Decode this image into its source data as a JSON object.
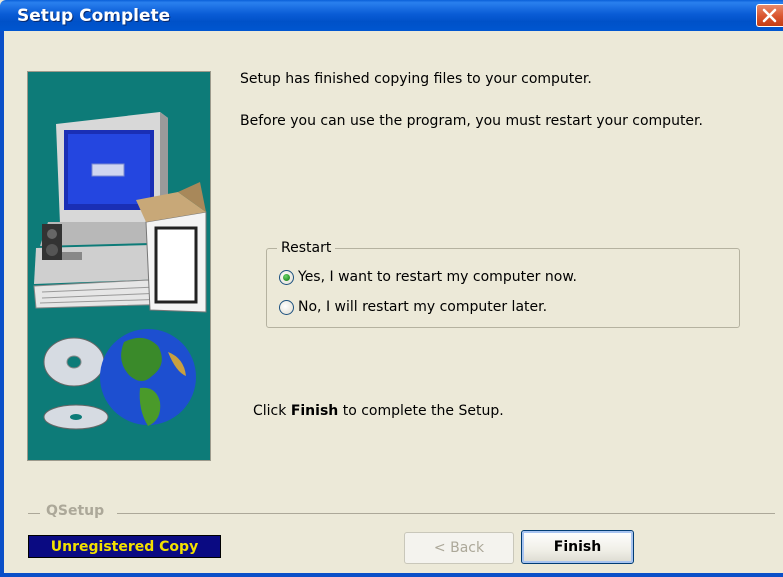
{
  "window": {
    "title": "Setup Complete"
  },
  "messages": {
    "line1": "Setup has finished copying files to your computer.",
    "line2": "Before you can use the program, you must restart your computer.",
    "finish_prefix": "Click ",
    "finish_bold": "Finish",
    "finish_suffix": " to complete the Setup."
  },
  "restart": {
    "legend": "Restart",
    "options": [
      {
        "label": "Yes, I want to restart my computer now.",
        "checked": true
      },
      {
        "label": "No, I will restart my computer later.",
        "checked": false
      }
    ]
  },
  "footer": {
    "group_label": "QSetup",
    "unregistered": "Unregistered Copy",
    "back_label": "< Back",
    "finish_label": "Finish"
  },
  "colors": {
    "titlebar": "#0054e3",
    "art_background": "#0d7b78",
    "unregistered_bg": "#0a0a82",
    "unregistered_fg": "#f2e000"
  },
  "icons": {
    "art": "computer-with-box-cds-globe-illustration",
    "close": "close-x-icon"
  }
}
